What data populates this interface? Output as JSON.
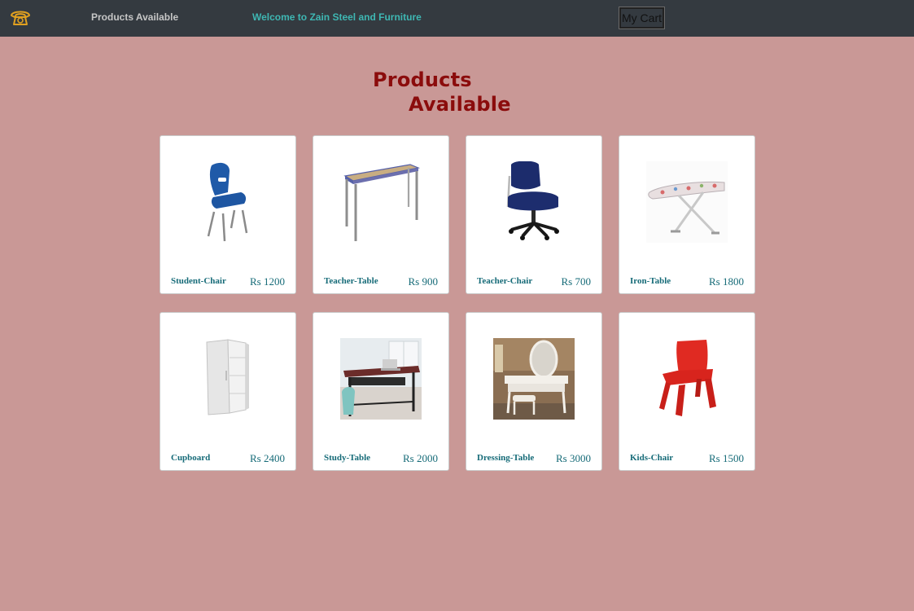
{
  "navbar": {
    "logo_icon": "phone-icon",
    "products_link": "Products Available",
    "welcome": "Welcome to Zain Steel and Furniture",
    "cart_button": "My Cart"
  },
  "heading": {
    "line1": "Products",
    "line2": "Available"
  },
  "colors": {
    "background": "#c99896",
    "navbar": "#343a40",
    "heading": "#8b0c0c",
    "welcome": "#3eb7b3",
    "product_text": "#166b78"
  },
  "products": [
    {
      "name": "Student-Chair",
      "price": "Rs 1200",
      "image": "student-chair-image"
    },
    {
      "name": "Teacher-Table",
      "price": "Rs 900",
      "image": "teacher-table-image"
    },
    {
      "name": "Teacher-Chair",
      "price": "Rs 700",
      "image": "teacher-chair-image"
    },
    {
      "name": "Iron-Table",
      "price": "Rs 1800",
      "image": "iron-table-image"
    },
    {
      "name": "Cupboard",
      "price": "Rs 2400",
      "image": "cupboard-image"
    },
    {
      "name": "Study-Table",
      "price": "Rs 2000",
      "image": "study-table-image"
    },
    {
      "name": "Dressing-Table",
      "price": "Rs 3000",
      "image": "dressing-table-image"
    },
    {
      "name": "Kids-Chair",
      "price": "Rs 1500",
      "image": "kids-chair-image"
    }
  ]
}
